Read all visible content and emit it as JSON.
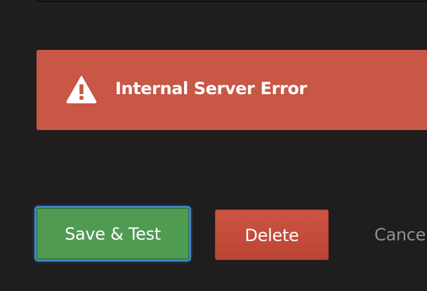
{
  "alert": {
    "icon": "warning-triangle-icon",
    "title": "Internal Server Error",
    "background_color": "#c85745"
  },
  "actions": {
    "save_test_label": "Save & Test",
    "delete_label": "Delete",
    "cancel_label": "Cancel",
    "save_color": "#4f9b52",
    "delete_color": "#c54c3b",
    "focus_ring_color": "#3f86c7"
  }
}
